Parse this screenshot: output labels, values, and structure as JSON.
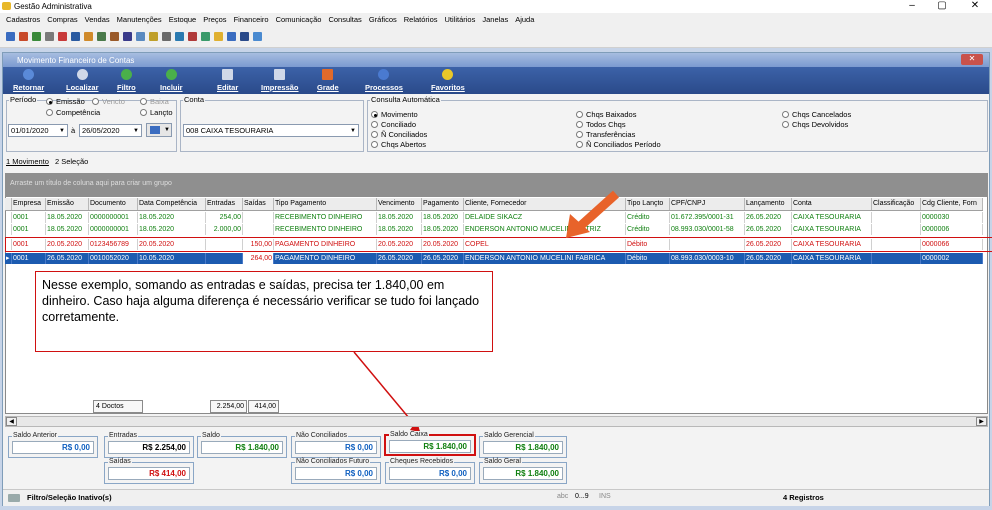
{
  "app_title": "Gestão Administrativa",
  "menu": [
    "Cadastros",
    "Compras",
    "Vendas",
    "Manutenções",
    "Estoque",
    "Preços",
    "Financeiro",
    "Comunicação",
    "Consultas",
    "Gráficos",
    "Relatórios",
    "Utilitários",
    "Janelas",
    "Ajuda"
  ],
  "window_title": "Movimento Financeiro de Contas",
  "ribbon": [
    "Retornar",
    "Localizar",
    "Filtro",
    "Incluir",
    "Editar",
    "Impressão",
    "Grade",
    "Processos",
    "Favoritos"
  ],
  "periodo": {
    "label": "Período",
    "opt_emissao": "Emissão",
    "opt_vencto": "Vencto",
    "opt_baixa": "Baixa",
    "opt_competencia": "Competência",
    "opt_lancto": "Lançto",
    "date_from": "01/01/2020",
    "date_sep": "à",
    "date_to": "26/05/2020"
  },
  "conta": {
    "label": "Conta",
    "value": "008  CAIXA TESOURARIA"
  },
  "consulta": {
    "label": "Consulta Automática",
    "options": [
      "Movimento",
      "Conciliado",
      "Ñ Conciliados",
      "Chqs Abertos",
      "Chqs Baixados",
      "Todos Chqs",
      "Transferências",
      "Ñ Conciliados Período",
      "Chqs Cancelados",
      "Chqs Devolvidos"
    ]
  },
  "tabs": [
    "1 Movimento",
    "2 Seleção"
  ],
  "grid_hint": "Arraste um título de coluna aqui para criar um grupo",
  "columns": [
    "Empresa",
    "Emissão",
    "Documento",
    "Data Competência",
    "Entradas",
    "Saídas",
    "Tipo Pagamento",
    "Vencimento",
    "Pagamento",
    "Cliente, Fornecedor",
    "Tipo Lançto",
    "CPF/CNPJ",
    "Lançamento",
    "Conta",
    "Classificação",
    "Cdg Cliente, Forn"
  ],
  "rows": [
    [
      "0001",
      "18.05.2020",
      "0000000001",
      "18.05.2020",
      "254,00",
      "",
      "RECEBIMENTO DINHEIRO",
      "18.05.2020",
      "18.05.2020",
      "DELAIDE SIKACZ",
      "Crédito",
      "01.672.395/0001-31",
      "26.05.2020",
      "CAIXA TESOURARIA",
      "",
      "0000030"
    ],
    [
      "0001",
      "18.05.2020",
      "0000000001",
      "18.05.2020",
      "2.000,00",
      "",
      "RECEBIMENTO DINHEIRO",
      "18.05.2020",
      "18.05.2020",
      "ENDERSON ANTONIO MUCELINI MATRIZ",
      "Crédito",
      "08.993.030/0001-58",
      "26.05.2020",
      "CAIXA TESOURARIA",
      "",
      "0000006"
    ],
    [
      "0001",
      "20.05.2020",
      "0123456789",
      "20.05.2020",
      "",
      "150,00",
      "PAGAMENTO DINHEIRO",
      "20.05.2020",
      "20.05.2020",
      "COPEL",
      "Débito",
      "",
      "26.05.2020",
      "CAIXA TESOURARIA",
      "",
      "0000066"
    ],
    [
      "0001",
      "26.05.2020",
      "0010052020",
      "10.05.2020",
      "",
      "264,00",
      "PAGAMENTO DINHEIRO",
      "26.05.2020",
      "26.05.2020",
      "ENDERSON ANTONIO MUCELINI FABRICA",
      "Débito",
      "08.993.030/0003-10",
      "26.05.2020",
      "CAIXA TESOURARIA",
      "",
      "0000002"
    ]
  ],
  "callout": "Nesse exemplo, somando as entradas e saídas, precisa ter 1.840,00 em dinheiro. Caso haja alguma diferença é necessário verificar se tudo foi lançado corretamente.",
  "totals": {
    "count": "4 Doctos",
    "entradas": "2.254,00",
    "saidas": "414,00"
  },
  "summary": {
    "saldo_anterior": {
      "label": "Saldo Anterior",
      "value": "R$ 0,00"
    },
    "entradas": {
      "label": "Entradas",
      "value": "R$ 2.254,00"
    },
    "saldo": {
      "label": "Saldo",
      "value": "R$ 1.840,00"
    },
    "nao_conciliados": {
      "label": "Não Conciliados",
      "value": "R$ 0,00"
    },
    "saldo_caixa": {
      "label": "Saldo Caixa",
      "value": "R$ 1.840,00"
    },
    "saldo_gerencial": {
      "label": "Saldo Gerencial",
      "value": "R$ 1.840,00"
    },
    "saidas": {
      "label": "Saídas",
      "value": "R$ 414,00"
    },
    "nao_conciliados_futuro": {
      "label": "Não Conciliados Futuro",
      "value": "R$ 0,00"
    },
    "cheques_recebidos": {
      "label": "Cheques Recebidos",
      "value": "R$ 0,00"
    },
    "saldo_geral": {
      "label": "Saldo Geral",
      "value": "R$ 1.840,00"
    }
  },
  "status": {
    "filter": "Filtro/Seleção Inativo(s)",
    "abc": "abc",
    "nums": "0...9",
    "ins": "INS",
    "records": "4 Registros"
  },
  "colors": {
    "accent": "#2a4a8a",
    "credit": "#108010",
    "debit": "#d01010",
    "selected": "#1c5bb0",
    "callout_border": "#d01010",
    "arrow": "#e8632a"
  }
}
